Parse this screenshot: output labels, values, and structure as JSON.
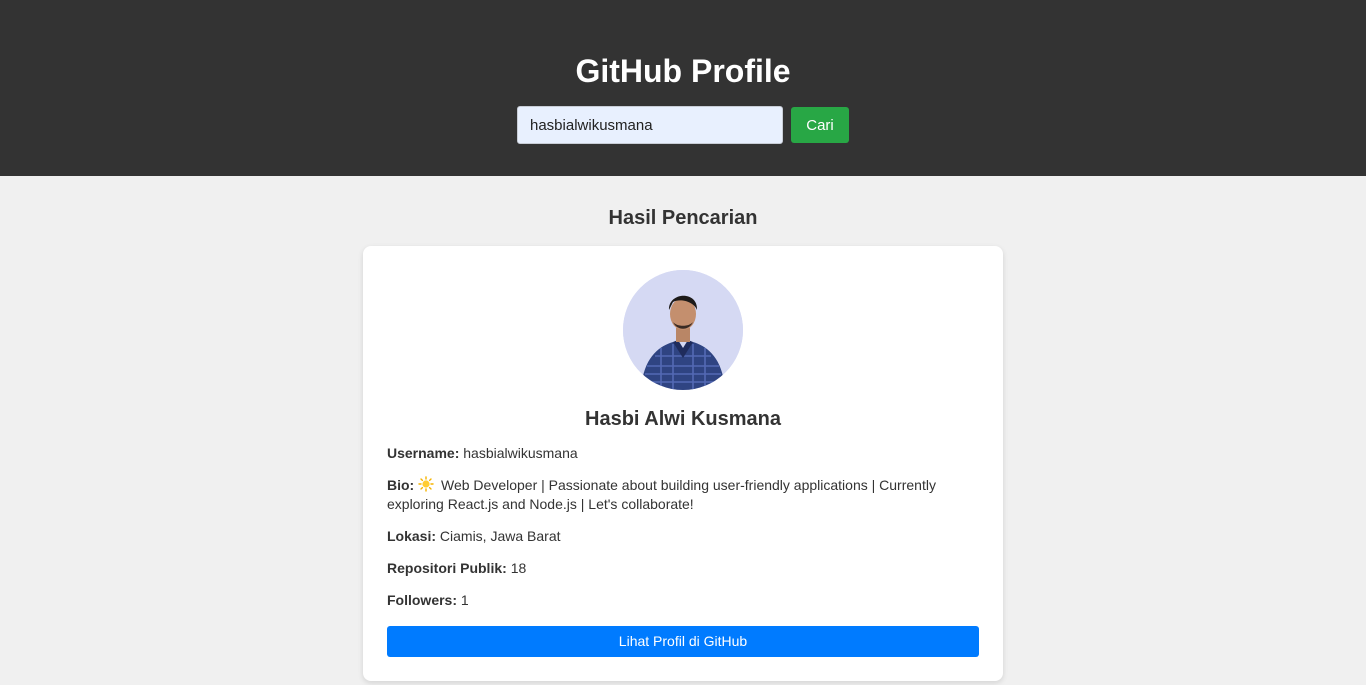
{
  "header": {
    "title": "GitHub Profile",
    "search_value": "hasbialwikusmana",
    "search_button": "Cari"
  },
  "results": {
    "heading": "Hasil Pencarian"
  },
  "profile": {
    "name": "Hasbi Alwi Kusmana",
    "username_label": "Username:",
    "username": "hasbialwikusmana",
    "bio_label": "Bio:",
    "bio_icon": "sun-emoji",
    "bio": "Web Developer | Passionate about building user-friendly applications | Currently exploring React.js and Node.js | Let's collaborate!",
    "location_label": "Lokasi:",
    "location": "Ciamis, Jawa Barat",
    "repos_label": "Repositori Publik:",
    "repos": "18",
    "followers_label": "Followers:",
    "followers": "1",
    "github_button": "Lihat Profil di GitHub"
  },
  "colors": {
    "header_bg": "#333333",
    "search_button": "#28a745",
    "github_button": "#007bff"
  }
}
